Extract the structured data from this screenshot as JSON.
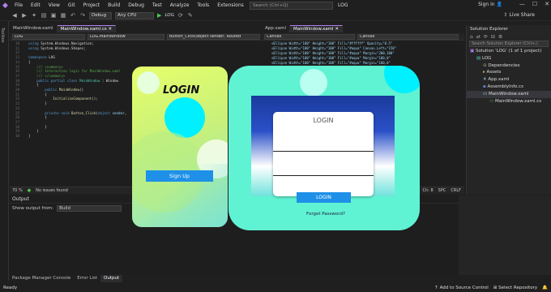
{
  "menu": {
    "items": [
      "File",
      "Edit",
      "View",
      "Git",
      "Project",
      "Build",
      "Debug",
      "Test",
      "Analyze",
      "Tools",
      "Extensions",
      "Window",
      "Help"
    ],
    "search_placeholder": "Search (Ctrl+Q)",
    "window_title": "LOG",
    "signin": "Sign in",
    "live_share": "Live Share"
  },
  "toolbar": {
    "config": "Debug",
    "platform": "Any CPU",
    "run_label": "LOG"
  },
  "left_strip": {
    "label": "Toolbox"
  },
  "editor_left": {
    "tabs": [
      "MainWindow.xaml",
      "MainWindow.xaml.cs"
    ],
    "active_tab": 1,
    "nav": [
      "LOG",
      "LOG.MainWindow",
      "Button_Click(object sender, Routed"
    ],
    "zoom": "70 %",
    "issues": "No issues found"
  },
  "editor_mid": {
    "tabs": [
      "App.xaml",
      "MainWindow.xaml"
    ],
    "active_tab": 1,
    "nav": [
      "Canvas",
      "Canvas"
    ],
    "status": [
      "Ch: 8",
      "SPC",
      "CRLF"
    ]
  },
  "solution_explorer": {
    "title": "Solution Explorer",
    "search_placeholder": "Search Solution Explorer (Ctrl+;)",
    "items": [
      {
        "label": "Solution 'LOG' (1 of 1 project)",
        "indent": 0
      },
      {
        "label": "LOG",
        "indent": 1
      },
      {
        "label": "Dependencies",
        "indent": 2
      },
      {
        "label": "Assets",
        "indent": 2
      },
      {
        "label": "App.xaml",
        "indent": 2
      },
      {
        "label": "AssemblyInfo.cs",
        "indent": 2
      },
      {
        "label": "MainWindow.xaml",
        "indent": 2
      },
      {
        "label": "MainWindow.xaml.cs",
        "indent": 3
      }
    ],
    "selected_index": 6
  },
  "output": {
    "title": "Output",
    "show_from_label": "Show output from:",
    "show_from_value": "Build"
  },
  "bottom_tabs": [
    "Package Manager Console",
    "Error List",
    "Output"
  ],
  "bottom_active": 2,
  "status_bar": {
    "ready": "Ready",
    "add_source": "Add to Source Control",
    "select_repo": "Select Repository"
  },
  "login_left": {
    "title": "LOGIN",
    "button": "Sign Up"
  },
  "login_right": {
    "title": "LOGIN",
    "button": "LOGIN",
    "forgot": "Forgot Password?"
  },
  "colors": {
    "accent": "#b180f0",
    "teal_card": "#5ff3d3",
    "cyan_circle": "#00f0ff",
    "button_blue": "#1e90e8",
    "statusbar": "#1f1f1f"
  }
}
